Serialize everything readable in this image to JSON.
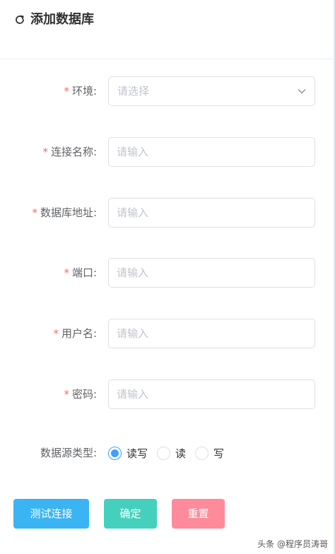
{
  "header": {
    "title": "添加数据库",
    "icon": "refresh-icon"
  },
  "form": {
    "environment": {
      "label": "环境:",
      "required": "*",
      "placeholder": "请选择"
    },
    "connection_name": {
      "label": "连接名称:",
      "required": "*",
      "placeholder": "请输入"
    },
    "db_address": {
      "label": "数据库地址:",
      "required": "*",
      "placeholder": "请输入"
    },
    "port": {
      "label": "端口:",
      "required": "*",
      "placeholder": "请输入"
    },
    "username": {
      "label": "用户名:",
      "required": "*",
      "placeholder": "请输入"
    },
    "password": {
      "label": "密码:",
      "required": "*",
      "placeholder": "请输入"
    },
    "source_type": {
      "label": "数据源类型:",
      "options": [
        "读写",
        "读",
        "写"
      ],
      "selected": "读写"
    }
  },
  "buttons": {
    "test": "测试连接",
    "confirm": "确定",
    "reset": "重置"
  },
  "watermark": "头条 @程序员涛哥",
  "colors": {
    "primary": "#409eff",
    "required": "#f56c6c",
    "test_button": "#3ab4f2",
    "confirm_button": "#45d0be",
    "reset_button": "#ff8b9a"
  }
}
